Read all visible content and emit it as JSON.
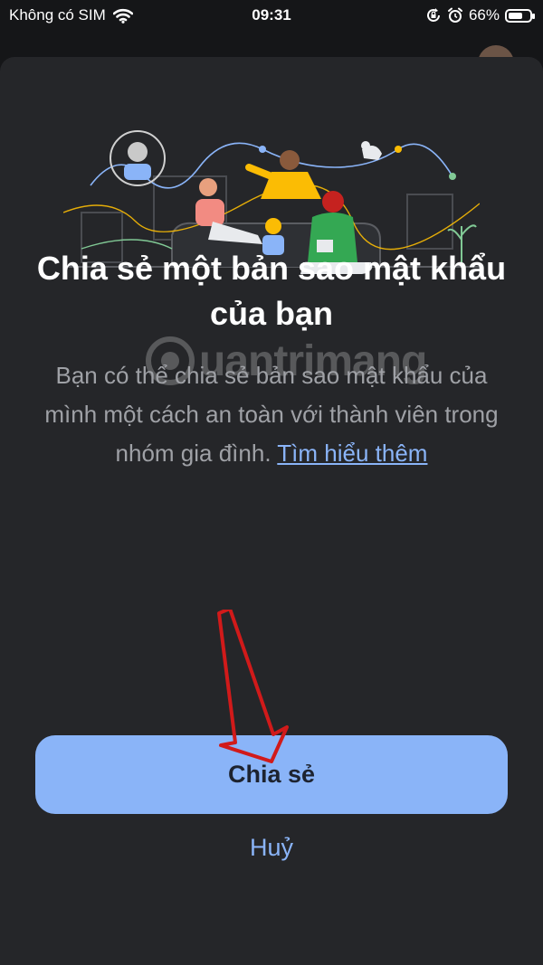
{
  "status_bar": {
    "carrier": "Không có SIM",
    "time": "09:31",
    "battery": "66%",
    "battery_level": 0.66,
    "icons": [
      "wifi-icon",
      "rotation-lock-icon",
      "alarm-icon",
      "battery-icon"
    ]
  },
  "sheet": {
    "title": "Chia sẻ một bản sao mật khẩu của bạn",
    "description": "Bạn có thể chia sẻ bản sao mật khẩu của mình một cách an toàn với thành viên trong nhóm gia đình.",
    "learn_more": "Tìm hiểu thêm",
    "share_button": "Chia sẻ",
    "cancel": "Huỷ"
  },
  "watermark": {
    "text": "uantrimang"
  },
  "colors": {
    "background": "#151618",
    "sheet": "#252629",
    "accent": "#8ab4f8",
    "button_text": "#1d2330",
    "secondary_text": "#9fa1a6",
    "annotation_arrow": "#d11a1a"
  }
}
